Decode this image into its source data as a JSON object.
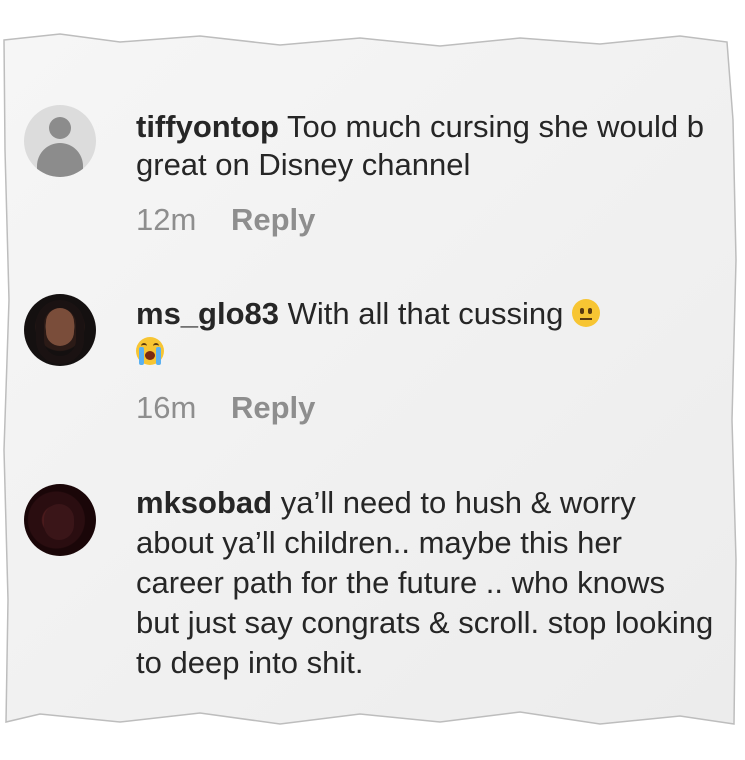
{
  "comments": [
    {
      "avatar": "default-profile-icon",
      "username": "tiffyontop",
      "text": "Too much cursing she would b great on Disney channel",
      "time": "12m",
      "reply_label": "Reply"
    },
    {
      "avatar": "profile-photo",
      "username": "ms_glo83",
      "text": "With all that cussing",
      "emojis": [
        "neutral-face-icon",
        "loudly-crying-face-icon"
      ],
      "time": "16m",
      "reply_label": "Reply"
    },
    {
      "avatar": "profile-photo",
      "username": "mksobad",
      "text": "ya’ll need to hush & worry about ya’ll children.. maybe this her career path for the future .. who knows but just say congrats & scroll. stop looking to deep into shit."
    }
  ],
  "colors": {
    "text": "#262626",
    "meta": "#8e8e8e",
    "paper": "#f3f3f3"
  }
}
